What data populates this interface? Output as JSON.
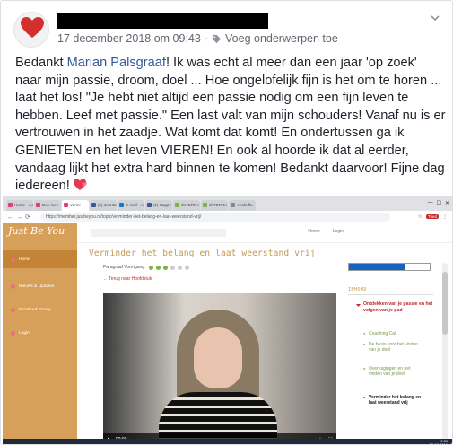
{
  "post": {
    "date": "17 december 2018 om 09:43",
    "add_topics": "Voeg onderwerpen toe",
    "text_before_mention": "Bedankt ",
    "mention": "Marian Palsgraaf",
    "text_after_mention": "! Ik was echt al meer dan een jaar 'op zoek' naar mijn passie, droom, doel ... Hoe ongelofelijk fijn is het om te horen ... laat het los! \"Je hebt niet altijd een passie nodig om een fijn leven te hebben. Leef met passie.\" Een last valt van mijn schouders! Vanaf nu is er vertrouwen in het zaadje. Wat komt dat komt! En ondertussen ga ik GENIETEN en het leven VIEREN! En ook al hoorde ik dat al eerder, vandaag lijkt het extra hard binnen te komen! Bedankt daarvoor! Fijne dag iedereen! ",
    "icons": {
      "heart_avatar": "heart-icon",
      "tag": "tag-icon",
      "chevron": "chevron-down-icon",
      "emoji": "two-hearts-emoji"
    }
  },
  "screenshot": {
    "tabs": [
      {
        "label": "Home - Ju",
        "color": "#e4406f"
      },
      {
        "label": "Doe mee",
        "color": "#e4406f"
      },
      {
        "label": "Vermi",
        "color": "#e4406f"
      },
      {
        "label": "(5) Just Be",
        "color": "#3b5998"
      },
      {
        "label": "E-mail - Ann",
        "color": "#1976d2"
      },
      {
        "label": "(1) Happy",
        "color": "#3b5998"
      },
      {
        "label": "doTERRA",
        "color": "#7cb342"
      },
      {
        "label": "doTERRA",
        "color": "#7cb342"
      },
      {
        "label": "Anshuflu",
        "color": "#888888"
      }
    ],
    "url": "https://member.justbeyou.nl/topic/verminder-het-belang-en-laat-weerstand-vrij/",
    "account_badge": "Tried",
    "site": {
      "logo": "Just Be You",
      "menu": [
        "Home",
        "Nieuws & Updates",
        "Facebook Groep",
        "Login"
      ],
      "nav": [
        "Home",
        "Login"
      ],
      "lesson_title": "Verminder het belang en laat weerstand vrij",
      "progress_label": "Paragraaf Voortgang:",
      "progress_dots_done": 3,
      "progress_dots_total": 6,
      "back_link": "← Terug naar Hoofdstuk",
      "video_time": "00:00",
      "video_progress": 0.06,
      "lesson_progress": 0.7,
      "toc_title": "INHOUD",
      "toc_section": "Ontdekken van je passie en het volgen van je pad",
      "toc_items": [
        {
          "label": "Coaching Call",
          "active": false
        },
        {
          "label": "De basis voor het vinden van je doel",
          "active": false
        },
        {
          "label": "Overtuigingen en het vinden van je doel",
          "active": false
        },
        {
          "label": "Verminder het belang en laat weerstand vrij",
          "active": true
        }
      ],
      "clock_time": "9:30",
      "clock_date": "17-12-2018"
    }
  }
}
